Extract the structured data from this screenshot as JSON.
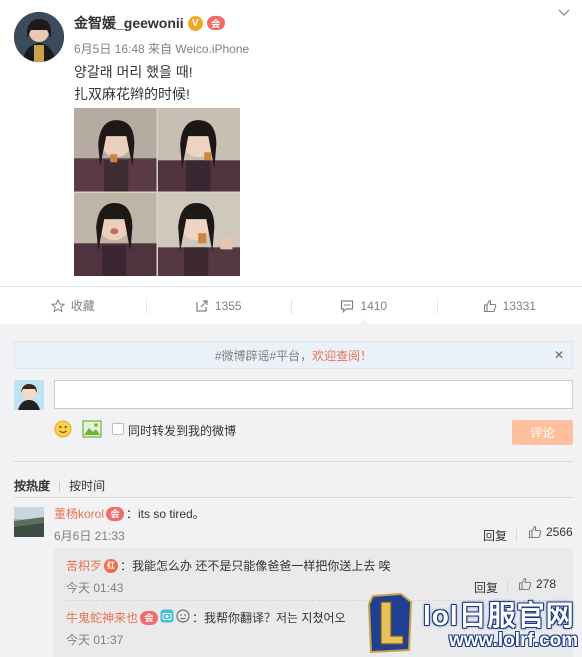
{
  "post": {
    "username": "金智媛_geewonii",
    "verified_badge": "V",
    "member_badge": "会",
    "time_source": "6月5日 16:48 来自 Weico.iPhone",
    "text_line_1": "양갈래 머리 했을 때!",
    "text_line_2": "扎双麻花辫的时候!",
    "collapse_icon": "chevron-down-icon"
  },
  "actions": [
    {
      "icon": "star-icon",
      "label": "收藏"
    },
    {
      "icon": "repost-icon",
      "label": "1355"
    },
    {
      "icon": "comment-icon",
      "label": "1410"
    },
    {
      "icon": "thumbs-up-icon",
      "label": "13331"
    }
  ],
  "notice": {
    "text": "#微博辟谣#平台，",
    "highlight": "欢迎查阅！",
    "close": "✕"
  },
  "composer": {
    "placeholder": "",
    "repost_label": "同时转发到我的微博",
    "submit_label": "评论"
  },
  "sort": {
    "hot": "按热度",
    "separator": "|",
    "time": "按时间"
  },
  "comment": {
    "username": "董杨korol",
    "member_badge": "会",
    "text": "：its so tired。",
    "time": "6月6日 21:33",
    "reply_label": "回复",
    "likes": "2566"
  },
  "replies": [
    {
      "username": "苦枳歹",
      "badge": "红",
      "text": "：我能怎么办 还不是只能像爸爸一样把你送上去 唉",
      "time": "今天 01:43",
      "reply_label": "回复",
      "likes": "278"
    },
    {
      "username": "牛鬼蛇神来也",
      "badge": "会",
      "text": "：我帮你翻译？저는 지쳤어오",
      "time": "今天 01:37"
    }
  ],
  "watermark": {
    "line_1": "lol日服官网",
    "line_2": "www.lolrf.com"
  },
  "colors": {
    "accent": "#eb7350",
    "link": "#eb7350",
    "submit_disabled": "#ffc09f",
    "panel_bg": "#f2f2f5"
  }
}
